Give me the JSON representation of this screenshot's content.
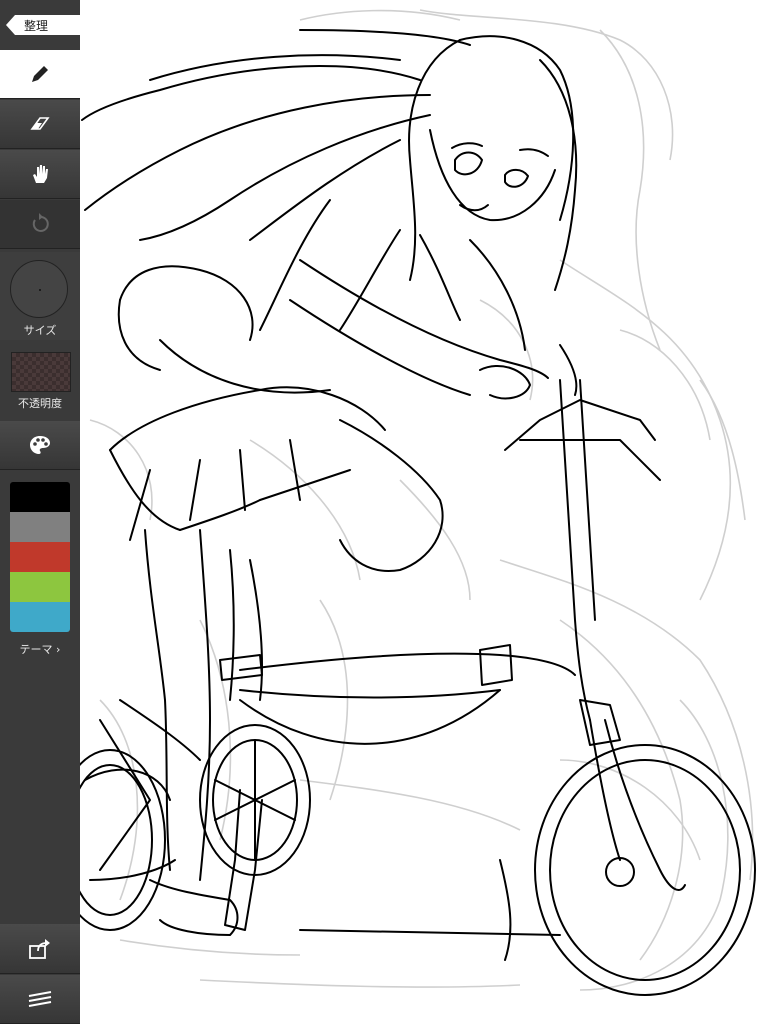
{
  "nav": {
    "back_label": "整理"
  },
  "size": {
    "label": "サイズ"
  },
  "opacity": {
    "label": "不透明度"
  },
  "palette": {
    "colors": [
      "#000000",
      "#808080",
      "#c0392b",
      "#8dc63f",
      "#3fa9c9"
    ],
    "theme_label": "テーマ",
    "theme_chevron": "›"
  },
  "tools": [
    "pen-icon",
    "eraser-icon",
    "hand-icon",
    "undo-icon",
    "palette-icon",
    "share-icon",
    "layers-icon"
  ]
}
